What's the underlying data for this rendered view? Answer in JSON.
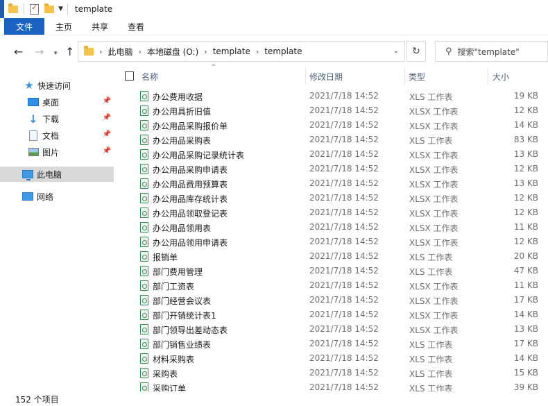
{
  "window": {
    "title": "template"
  },
  "ribbon": {
    "tabs": [
      "文件",
      "主页",
      "共享",
      "查看"
    ]
  },
  "address": {
    "crumbs": [
      "此电脑",
      "本地磁盘 (O:)",
      "template",
      "template"
    ],
    "search_placeholder": "搜索\"template\""
  },
  "nav": {
    "items": [
      {
        "label": "快速访问",
        "icon": "star-icon",
        "pinned": false
      },
      {
        "label": "桌面",
        "icon": "desktop-icon",
        "pinned": true
      },
      {
        "label": "下载",
        "icon": "download-icon",
        "pinned": true
      },
      {
        "label": "文档",
        "icon": "document-icon",
        "pinned": true
      },
      {
        "label": "图片",
        "icon": "pictures-icon",
        "pinned": true
      },
      {
        "label": "此电脑",
        "icon": "computer-icon",
        "pinned": false,
        "selected": true
      },
      {
        "label": "网络",
        "icon": "network-icon",
        "pinned": false
      }
    ]
  },
  "columns": [
    "名称",
    "修改日期",
    "类型",
    "大小"
  ],
  "files": [
    {
      "name": "办公费用收据",
      "date": "2021/7/18 14:52",
      "type": "XLS 工作表",
      "size": "19 KB"
    },
    {
      "name": "办公用具折旧值",
      "date": "2021/7/18 14:52",
      "type": "XLSX 工作表",
      "size": "12 KB"
    },
    {
      "name": "办公用品采购报价单",
      "date": "2021/7/18 14:52",
      "type": "XLSX 工作表",
      "size": "14 KB"
    },
    {
      "name": "办公用品采购表",
      "date": "2021/7/18 14:52",
      "type": "XLS 工作表",
      "size": "83 KB"
    },
    {
      "name": "办公用品采购记录统计表",
      "date": "2021/7/18 14:52",
      "type": "XLSX 工作表",
      "size": "13 KB"
    },
    {
      "name": "办公用品采购申请表",
      "date": "2021/7/18 14:52",
      "type": "XLSX 工作表",
      "size": "12 KB"
    },
    {
      "name": "办公用品费用预算表",
      "date": "2021/7/18 14:52",
      "type": "XLSX 工作表",
      "size": "13 KB"
    },
    {
      "name": "办公用品库存统计表",
      "date": "2021/7/18 14:52",
      "type": "XLSX 工作表",
      "size": "12 KB"
    },
    {
      "name": "办公用品领取登记表",
      "date": "2021/7/18 14:52",
      "type": "XLSX 工作表",
      "size": "12 KB"
    },
    {
      "name": "办公用品领用表",
      "date": "2021/7/18 14:52",
      "type": "XLSX 工作表",
      "size": "11 KB"
    },
    {
      "name": "办公用品领用申请表",
      "date": "2021/7/18 14:52",
      "type": "XLSX 工作表",
      "size": "12 KB"
    },
    {
      "name": "报销单",
      "date": "2021/7/18 14:52",
      "type": "XLS 工作表",
      "size": "20 KB"
    },
    {
      "name": "部门费用管理",
      "date": "2021/7/18 14:52",
      "type": "XLS 工作表",
      "size": "47 KB"
    },
    {
      "name": "部门工资表",
      "date": "2021/7/18 14:52",
      "type": "XLSX 工作表",
      "size": "11 KB"
    },
    {
      "name": "部门经营会议表",
      "date": "2021/7/18 14:52",
      "type": "XLSX 工作表",
      "size": "17 KB"
    },
    {
      "name": "部门开销统计表1",
      "date": "2021/7/18 14:52",
      "type": "XLSX 工作表",
      "size": "14 KB"
    },
    {
      "name": "部门领导出差动态表",
      "date": "2021/7/18 14:52",
      "type": "XLSX 工作表",
      "size": "13 KB"
    },
    {
      "name": "部门销售业绩表",
      "date": "2021/7/18 14:52",
      "type": "XLS 工作表",
      "size": "17 KB"
    },
    {
      "name": "材料采购表",
      "date": "2021/7/18 14:52",
      "type": "XLS 工作表",
      "size": "14 KB"
    },
    {
      "name": "采购表",
      "date": "2021/7/18 14:52",
      "type": "XLS 工作表",
      "size": "15 KB"
    },
    {
      "name": "采购订单",
      "date": "2021/7/18 14:52",
      "type": "XLS 工作表",
      "size": "39 KB"
    }
  ],
  "status": {
    "item_count": "152 个项目"
  }
}
